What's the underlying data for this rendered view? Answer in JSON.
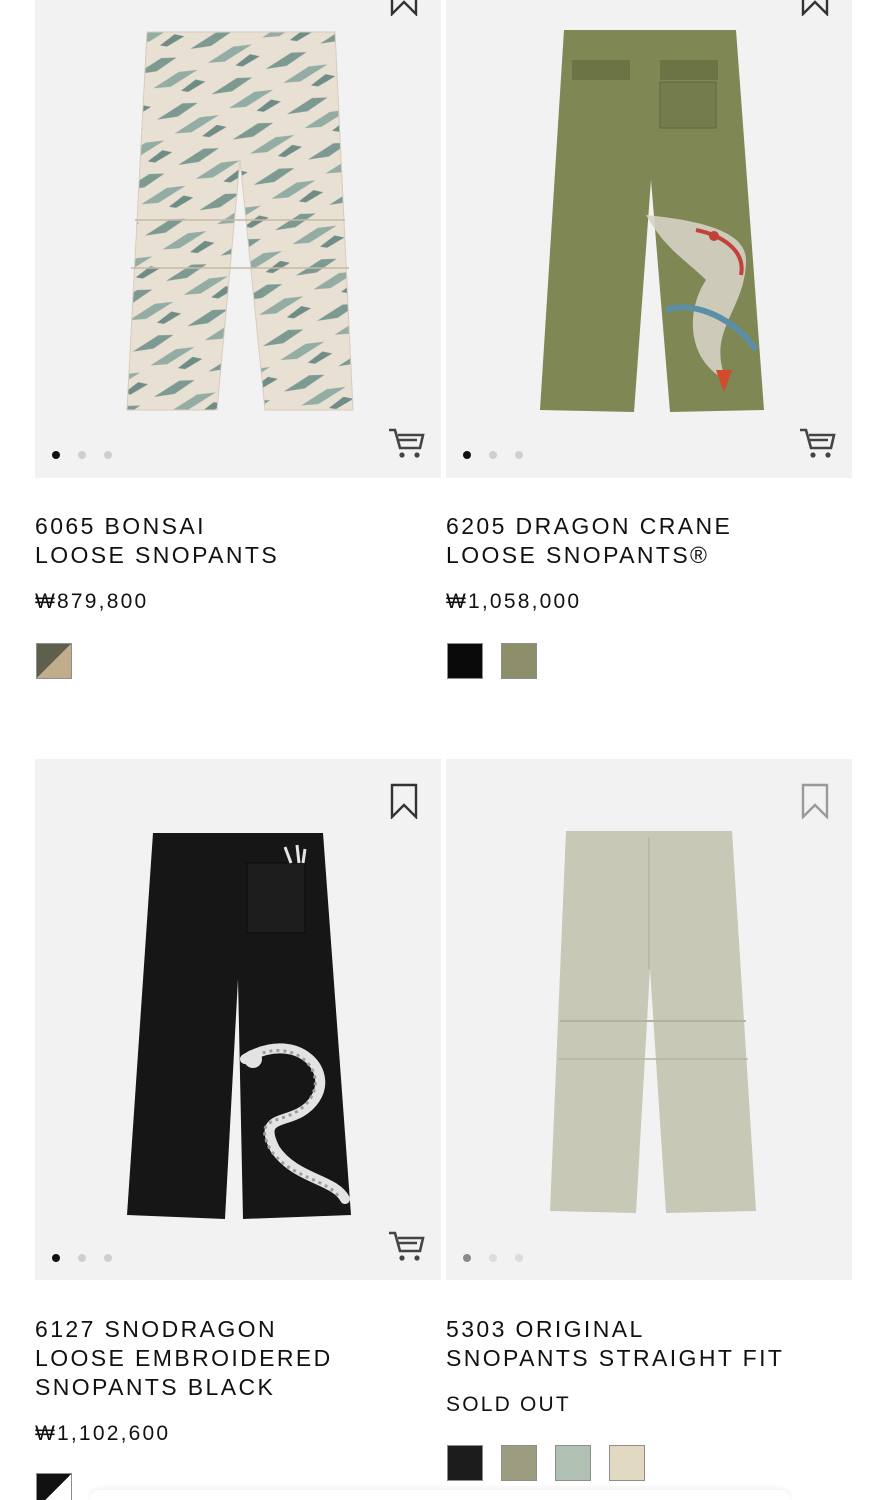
{
  "products": [
    {
      "sku": "6065",
      "name_line1": "6065  BONSAI",
      "name_line2": "LOOSE SNOPANTS",
      "name_line3": "",
      "price": "₩879,800",
      "image_desc": "camouflage-pants",
      "swatch_colors": [
        "#9d9280"
      ],
      "swatch_split": true
    },
    {
      "sku": "6205",
      "name_line1": "6205  DRAGON CRANE",
      "name_line2": "LOOSE SNOPANTS®",
      "name_line3": "",
      "price": "₩1,058,000",
      "image_desc": "olive-pants-crane-embroidery",
      "swatch_colors": [
        "#0a0a0a",
        "#8c8f6a"
      ]
    },
    {
      "sku": "6127",
      "name_line1": "6127  SNODRAGON",
      "name_line2": "LOOSE EMBROIDERED",
      "name_line3": "SNOPANTS BLACK",
      "price": "₩1,102,600",
      "image_desc": "black-pants-dragon-embroidery",
      "swatch_colors": [
        "#111111"
      ]
    },
    {
      "sku": "5303",
      "name_line1": "5303  ORIGINAL",
      "name_line2": "SNOPANTS STRAIGHT FIT",
      "name_line3": "",
      "price": "SOLD OUT",
      "image_desc": "sage-pants",
      "swatch_colors": [
        "#1c1c1c",
        "#9c9d80",
        "#b0c0b3",
        "#e2d9c3"
      ]
    }
  ],
  "icons": {
    "bookmark": "bookmark-icon",
    "cart": "cart-icon"
  },
  "colors": {
    "text": "#111111",
    "card_bg": "#f2f2f2",
    "dot_inactive": "#cfcfcf",
    "dot_active": "#111111"
  }
}
